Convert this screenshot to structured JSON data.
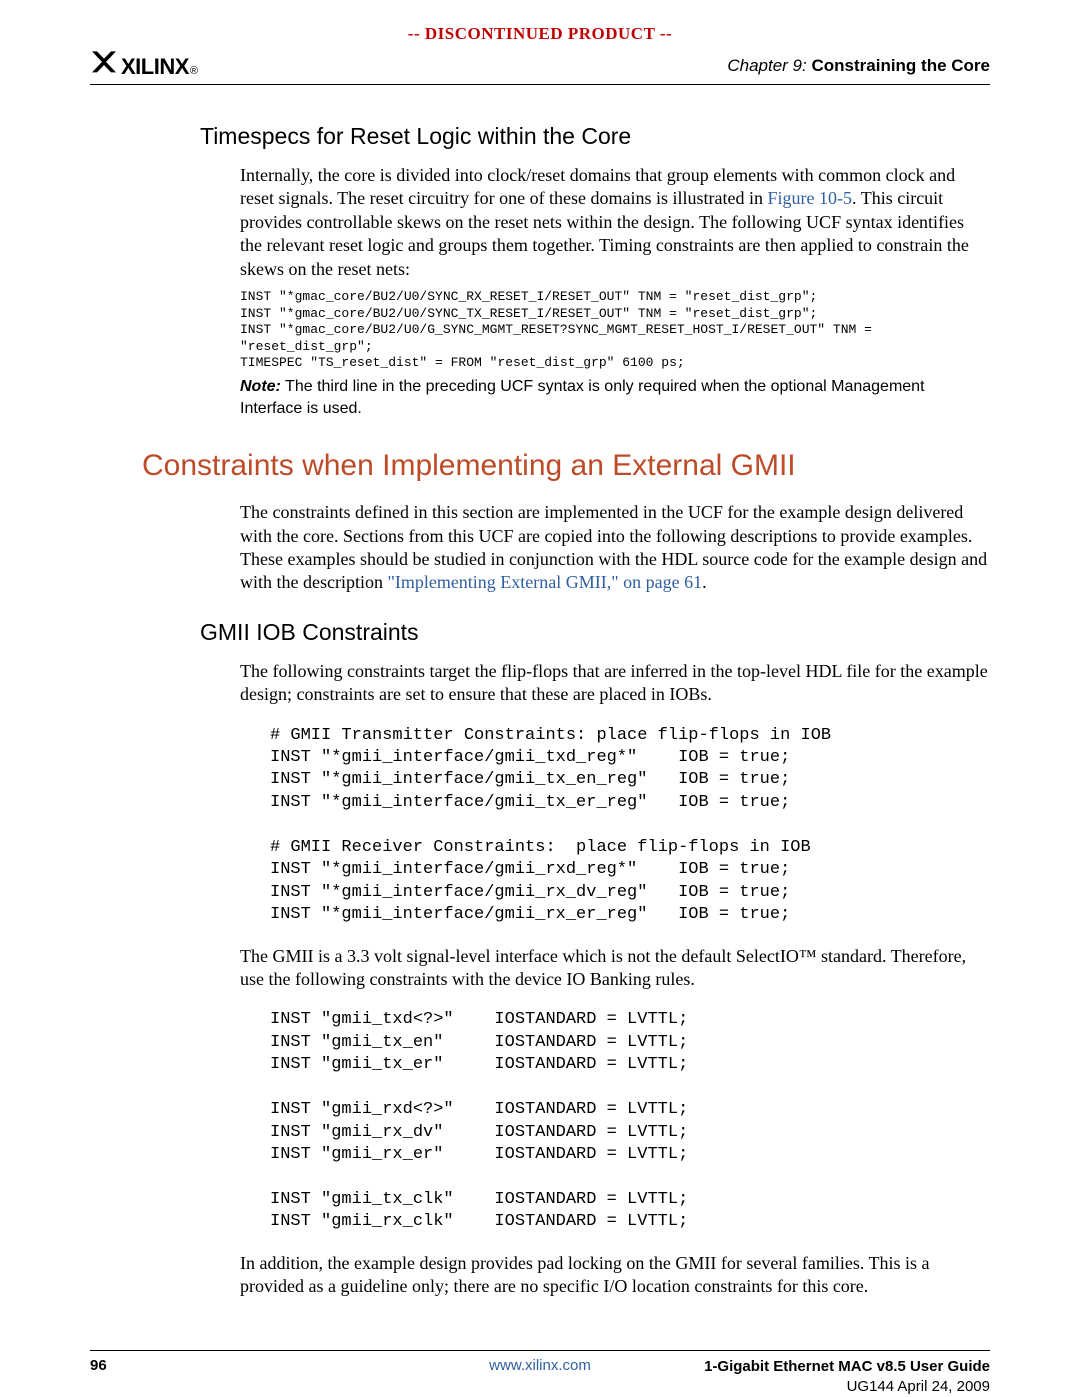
{
  "banner": "-- DISCONTINUED PRODUCT --",
  "logo": {
    "mark": "X",
    "name": "XILINX",
    "reg": "®"
  },
  "chapter": {
    "label": "Chapter 9:",
    "title": "Constraining the Core"
  },
  "sec1": {
    "title": "Timespecs for Reset Logic within the Core",
    "para_a": "Internally, the core is divided into clock/reset domains that group elements with common clock and reset signals. The reset circuitry for one of these domains is illustrated in ",
    "fig_link": "Figure 10-5",
    "para_b": ". This circuit provides controllable skews on the reset nets within the design. The following UCF syntax identifies the relevant reset logic and groups them together. Timing constraints are then applied to constrain the skews on the reset nets:",
    "code": "INST \"*gmac_core/BU2/U0/SYNC_RX_RESET_I/RESET_OUT\" TNM = \"reset_dist_grp\";\nINST \"*gmac_core/BU2/U0/SYNC_TX_RESET_I/RESET_OUT\" TNM = \"reset_dist_grp\";\nINST \"*gmac_core/BU2/U0/G_SYNC_MGMT_RESET?SYNC_MGMT_RESET_HOST_I/RESET_OUT\" TNM =\n\"reset_dist_grp\";\nTIMESPEC \"TS_reset_dist\" = FROM \"reset_dist_grp\" 6100 ps;",
    "note_lead": "Note:",
    "note_body": "  The third line in the preceding UCF syntax is only required when the optional Management Interface is used."
  },
  "sec2": {
    "title": "Constraints when Implementing an External GMII",
    "para_a": "The constraints defined in this section are implemented in the UCF for the example design delivered with the core. Sections from this UCF are copied into the following descriptions to provide examples. These examples should be studied in conjunction with the HDL source code for the example design and with the description ",
    "link": "\"Implementing External GMII,\" on page 61",
    "para_b": "."
  },
  "sec3": {
    "title": "GMII IOB Constraints",
    "para1": "The following constraints target the flip-flops that are inferred in the top-level HDL file for the example design; constraints are set to ensure that these are placed in IOBs.",
    "code1": "# GMII Transmitter Constraints: place flip-flops in IOB\nINST \"*gmii_interface/gmii_txd_reg*\"    IOB = true;\nINST \"*gmii_interface/gmii_tx_en_reg\"   IOB = true;\nINST \"*gmii_interface/gmii_tx_er_reg\"   IOB = true;\n\n# GMII Receiver Constraints:  place flip-flops in IOB\nINST \"*gmii_interface/gmii_rxd_reg*\"    IOB = true;\nINST \"*gmii_interface/gmii_rx_dv_reg\"   IOB = true;\nINST \"*gmii_interface/gmii_rx_er_reg\"   IOB = true;",
    "para2": "The GMII is a 3.3 volt signal-level interface which is not the default SelectIO™ standard. Therefore, use the following constraints with the device IO Banking rules.",
    "code2": "INST \"gmii_txd<?>\"    IOSTANDARD = LVTTL;\nINST \"gmii_tx_en\"     IOSTANDARD = LVTTL;\nINST \"gmii_tx_er\"     IOSTANDARD = LVTTL;\n\nINST \"gmii_rxd<?>\"    IOSTANDARD = LVTTL;\nINST \"gmii_rx_dv\"     IOSTANDARD = LVTTL;\nINST \"gmii_rx_er\"     IOSTANDARD = LVTTL;\n\nINST \"gmii_tx_clk\"    IOSTANDARD = LVTTL;\nINST \"gmii_rx_clk\"    IOSTANDARD = LVTTL;",
    "para3": "In addition, the example design provides pad locking on the GMII for several families. This is a provided as a guideline only; there are no specific I/O location constraints for this core."
  },
  "footer": {
    "page": "96",
    "link": "www.xilinx.com",
    "title": "1-Gigabit Ethernet MAC v8.5 User Guide",
    "sub": "UG144 April 24, 2009"
  }
}
